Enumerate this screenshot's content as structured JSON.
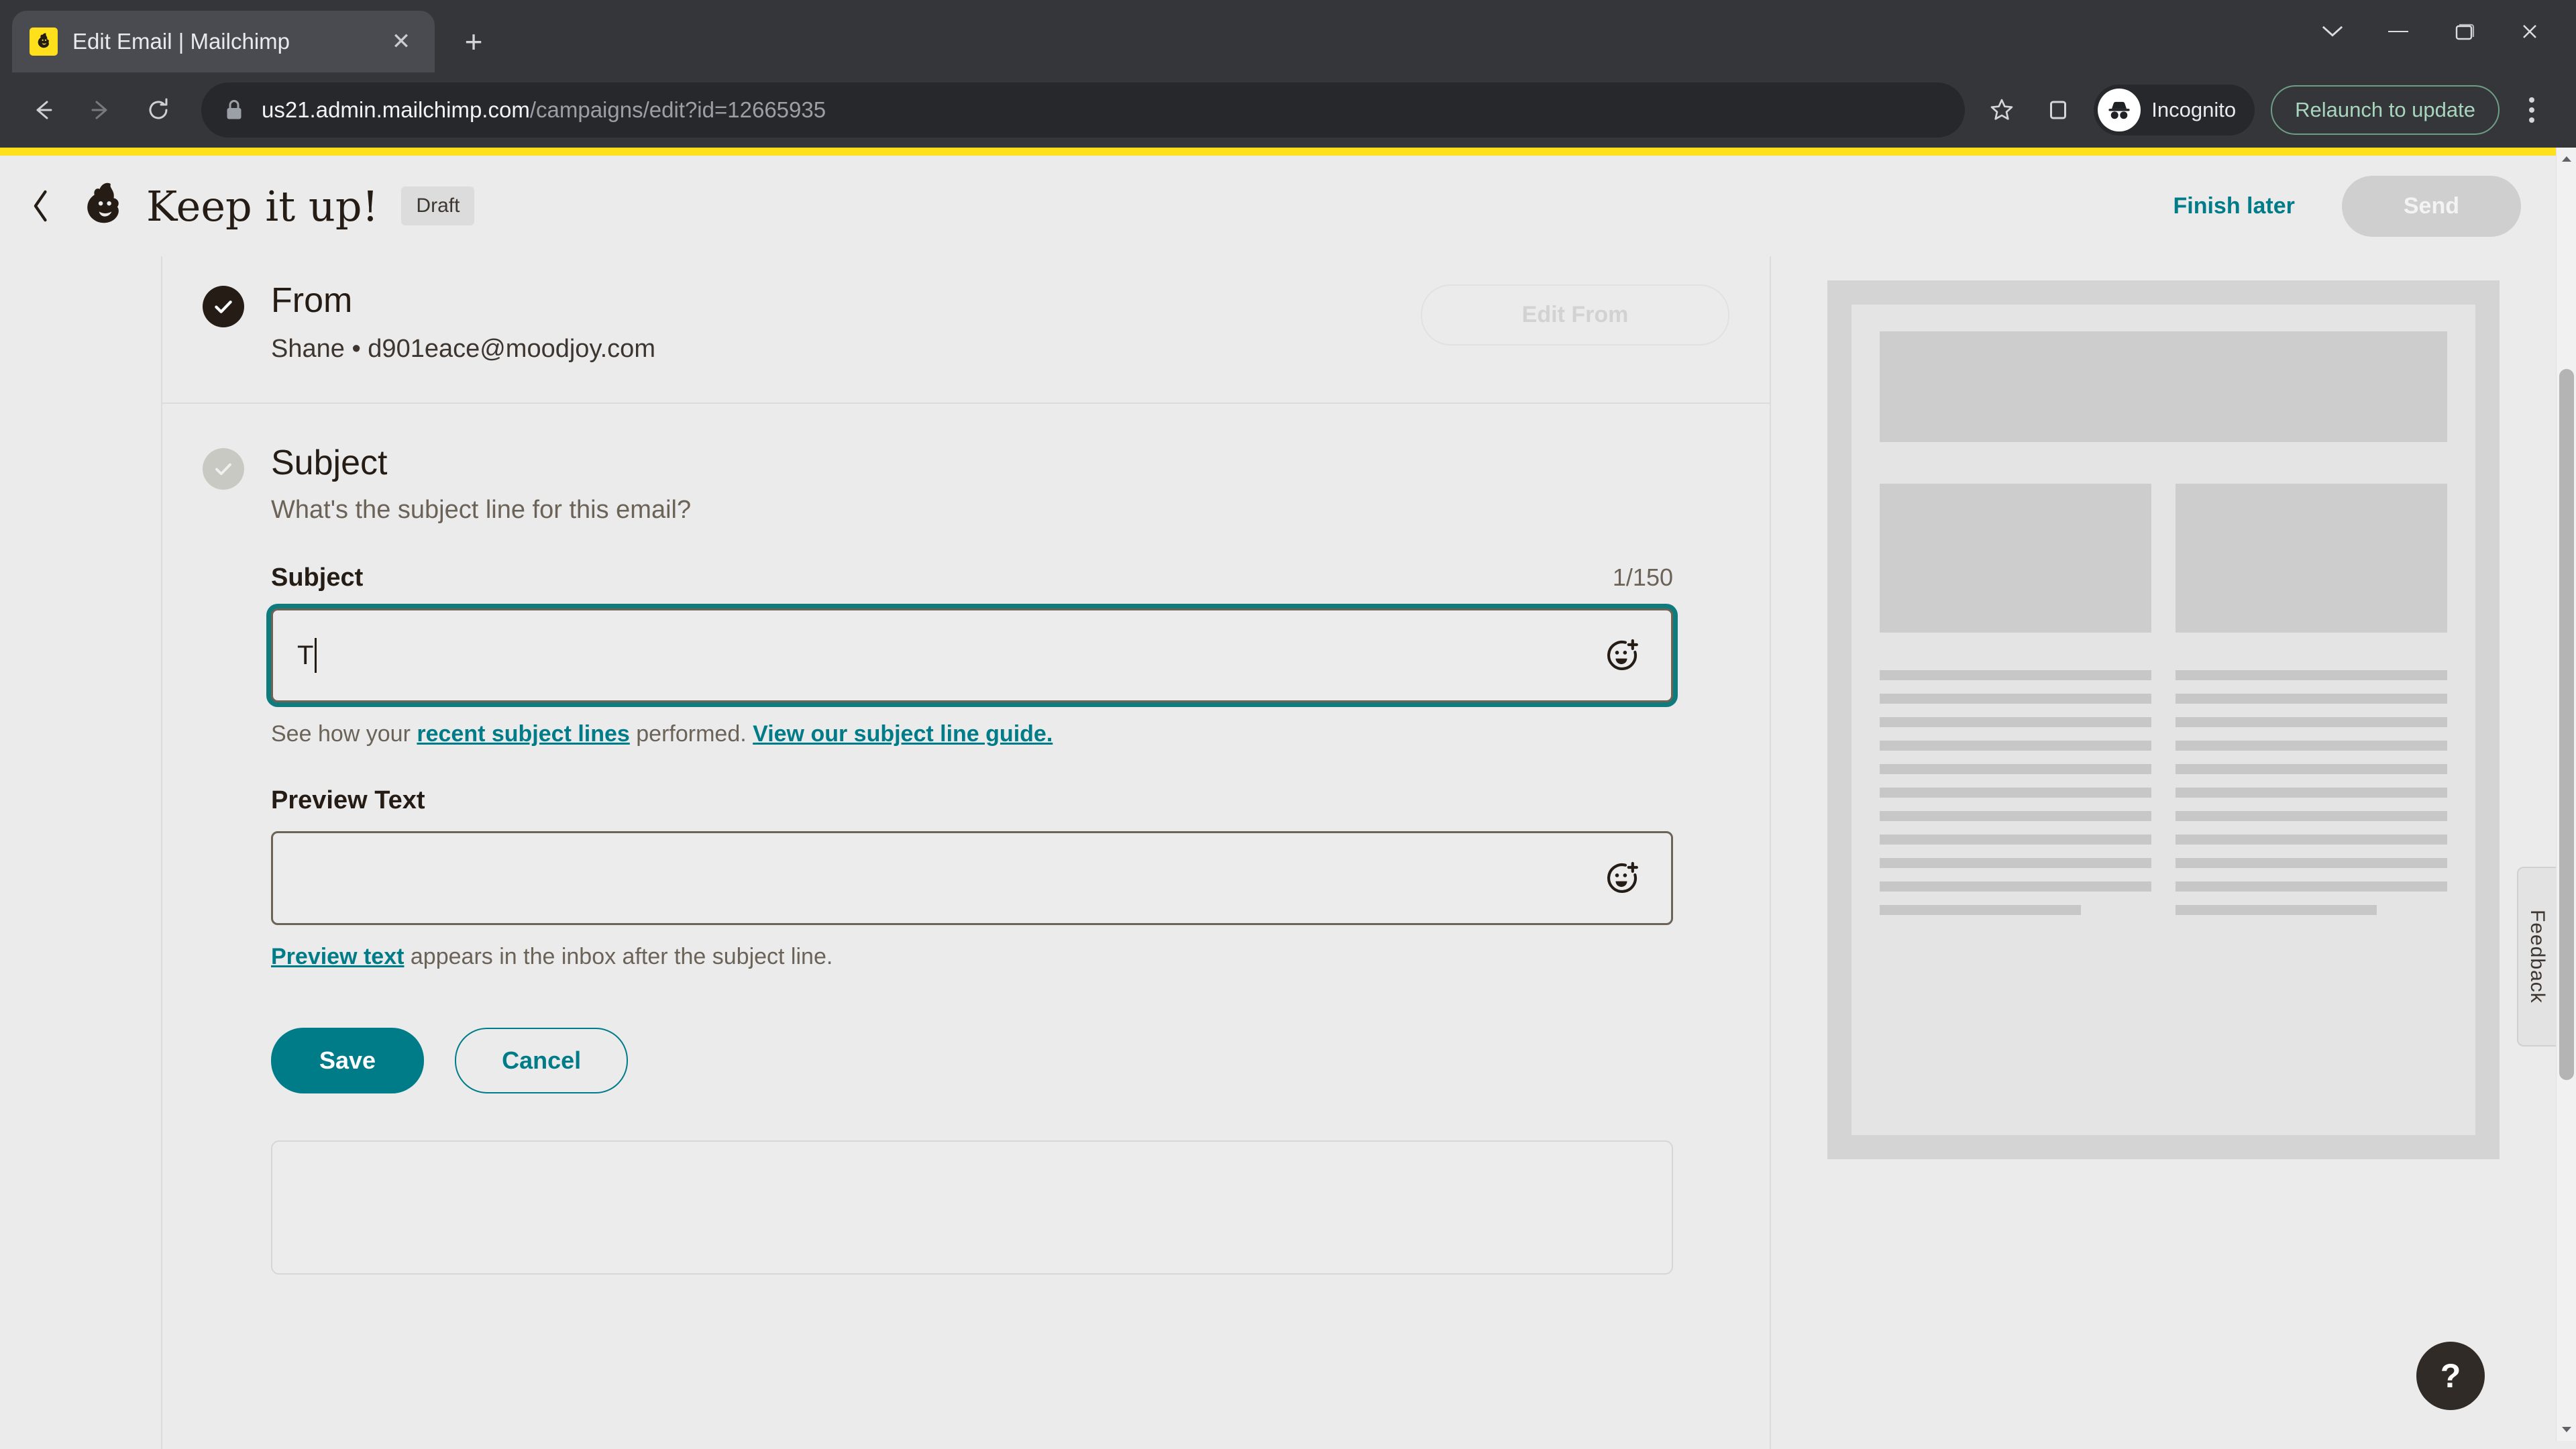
{
  "browser": {
    "tab": {
      "title": "Edit Email | Mailchimp",
      "favicon_name": "mailchimp-favicon",
      "close_label": "✕"
    },
    "new_tab_label": "+",
    "window_controls": {
      "minimize_label": "⌄",
      "collapse_label": "─",
      "maximize_label": "❐",
      "close_label": "✕"
    },
    "nav": {
      "back_label": "←",
      "forward_label": "→",
      "reload_label": "⟳"
    },
    "omnibox": {
      "host": "us21.admin.mailchimp.com",
      "path": "/campaigns/edit?id=12665935",
      "lock_icon": "lock-icon"
    },
    "actions": {
      "bookmark_label": "☆",
      "sidepanel_label": "▢",
      "incognito_label": "Incognito",
      "relaunch_label": "Relaunch to update",
      "menu_label": "menu-kebab"
    }
  },
  "app": {
    "header": {
      "back_label": "‹",
      "campaign_title": "Keep it up!",
      "status_badge": "Draft",
      "finish_later_label": "Finish later",
      "send_label": "Send"
    },
    "from_section": {
      "heading": "From",
      "value": "Shane • d901eace@moodjoy.com",
      "edit_button_label": "Edit From",
      "state": "complete"
    },
    "subject_section": {
      "heading": "Subject",
      "description": "What's the subject line for this email?",
      "state": "complete",
      "subject_field": {
        "label": "Subject",
        "char_count": "1/150",
        "value": "T",
        "placeholder": "",
        "emoji_icon": "emoji-add-icon",
        "focused": true
      },
      "subject_helper": {
        "prefix": "See how your ",
        "link1": "recent subject lines",
        "middle": " performed. ",
        "link2": "View our subject line guide."
      },
      "preview_field": {
        "label": "Preview Text",
        "value": "",
        "placeholder": "",
        "emoji_icon": "emoji-add-icon"
      },
      "preview_helper": {
        "link": "Preview text",
        "suffix": " appears in the inbox after the subject line."
      },
      "save_label": "Save",
      "cancel_label": "Cancel"
    },
    "preview_panel": {
      "name": "email-preview-skeleton",
      "line_count": 11
    },
    "feedback_tab_label": "Feedback",
    "help_label": "?"
  },
  "colors": {
    "brand_yellow": "#ffe01b",
    "teal": "#007c89",
    "focus_ring": "#0f7b7d",
    "page_bg": "#ebebeb",
    "ink": "#241c15",
    "muted": "#6b6258"
  }
}
